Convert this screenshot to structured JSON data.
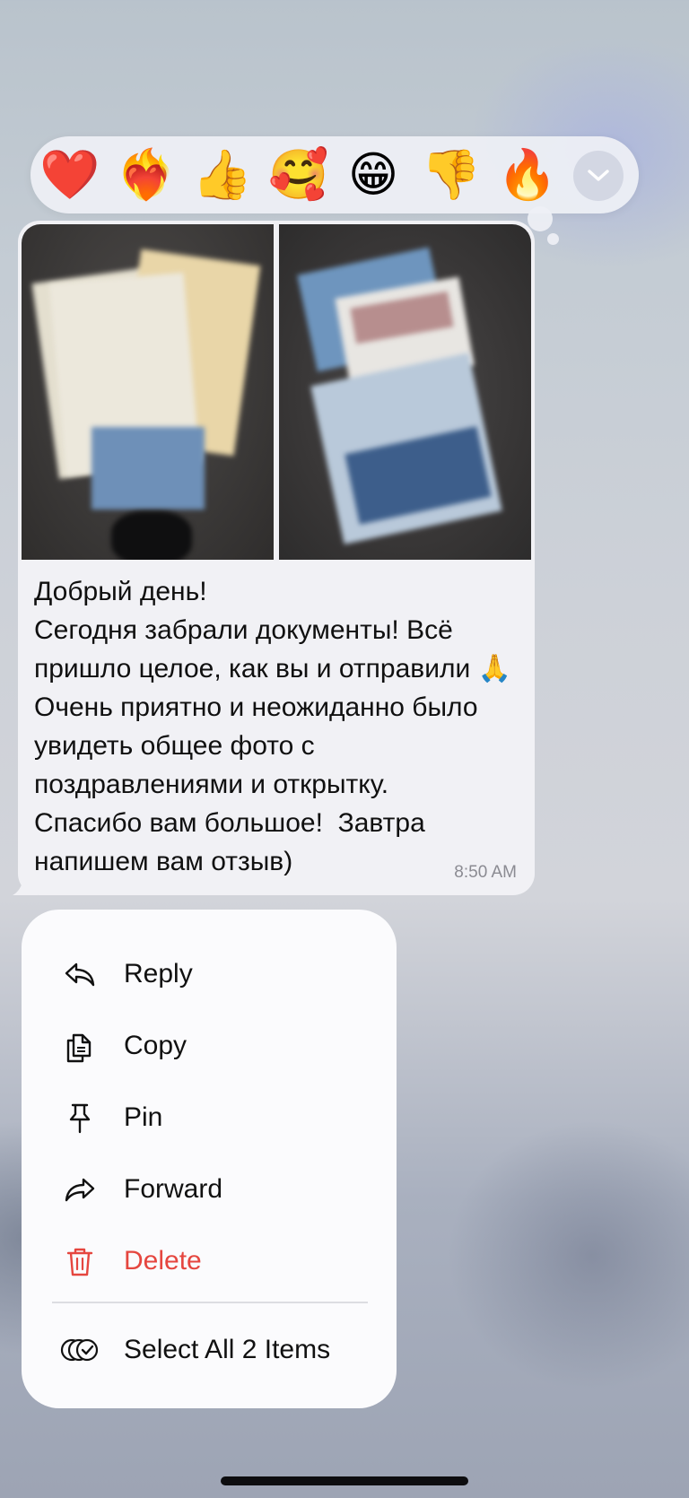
{
  "reactions": [
    {
      "emoji": "❤️",
      "name": "red-heart"
    },
    {
      "emoji": "❤️‍🔥",
      "name": "heart-on-fire"
    },
    {
      "emoji": "👍",
      "name": "thumbs-up"
    },
    {
      "emoji": "🥰",
      "name": "smiling-face-with-hearts"
    },
    {
      "emoji": "😁",
      "name": "beaming-face"
    },
    {
      "emoji": "👎",
      "name": "thumbs-down"
    },
    {
      "emoji": "🔥",
      "name": "fire"
    }
  ],
  "message": {
    "text": "Добрый день!\nСегодня забрали документы! Всё пришло целое, как вы и отправили 🙏 Очень приятно и неожиданно было увидеть общее фото с поздравлениями и открытку.\nСпасибо вам большое!  Завтра напишем вам отзыв)",
    "time": "8:50 AM",
    "photos": [
      {
        "icon": "photo-documents"
      },
      {
        "icon": "photo-envelope-postcard"
      }
    ]
  },
  "menu": {
    "items": [
      {
        "label": "Reply",
        "icon": "reply-icon"
      },
      {
        "label": "Copy",
        "icon": "copy-icon"
      },
      {
        "label": "Pin",
        "icon": "pin-icon"
      },
      {
        "label": "Forward",
        "icon": "forward-icon"
      },
      {
        "label": "Delete",
        "icon": "trash-icon",
        "color": "#e5463f"
      }
    ],
    "select_all_label": "Select All 2 Items"
  },
  "colors": {
    "bubble": "#f1f1f5",
    "menu": "#fbfbfd",
    "danger": "#e5463f"
  }
}
